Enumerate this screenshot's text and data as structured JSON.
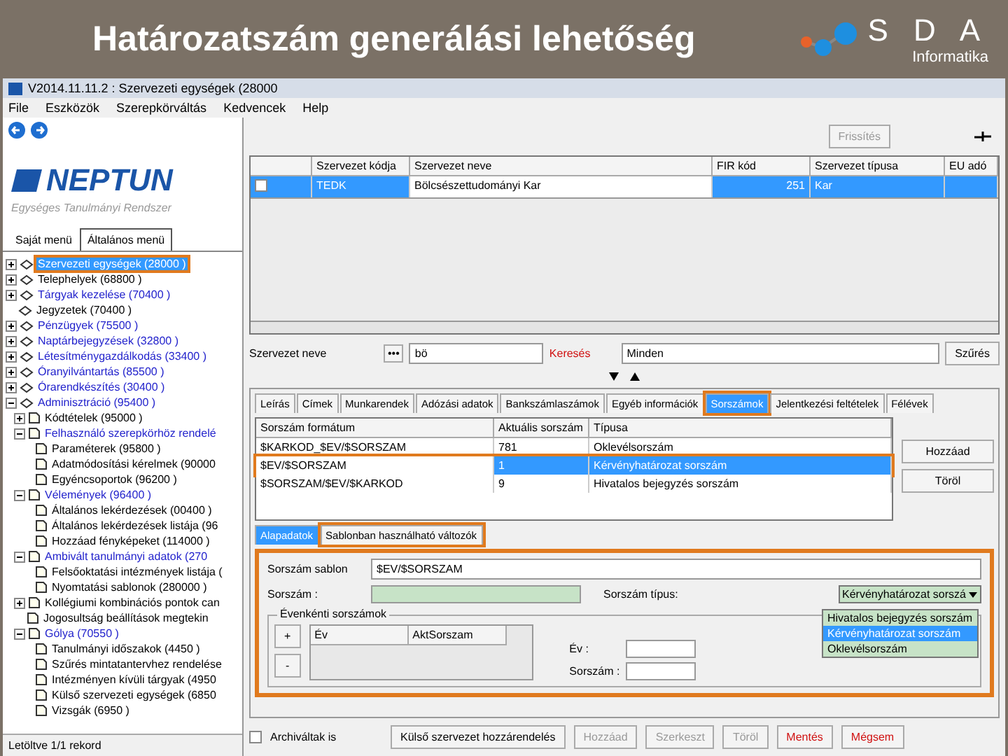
{
  "slide": {
    "title": "Határozatszám generálási lehetőség",
    "logo": {
      "letters": "S D A",
      "subtitle": "Informatika"
    }
  },
  "window": {
    "title": "V2014.11.11.2 : Szervezeti egységek (28000"
  },
  "menu": [
    "File",
    "Eszközök",
    "Szerepkörváltás",
    "Kedvencek",
    "Help"
  ],
  "sidebar": {
    "logo": "NEPTUN",
    "tagline": "Egységes Tanulmányi Rendszer",
    "tabs": [
      {
        "label": "Saját menü",
        "selected": false
      },
      {
        "label": "Általános menü",
        "selected": true
      }
    ],
    "tree": [
      {
        "label": "Szervezeti egységek (28000 )",
        "selected": true,
        "highlighted": true,
        "expanded": false
      },
      {
        "label": "Telephelyek (68800 )",
        "color": "#000000",
        "selected": false,
        "highlighted": false,
        "expanded": false
      },
      {
        "label": "Tárgyak kezelése (70400 )",
        "color": "#2222cc",
        "selected": false,
        "highlighted": false,
        "expanded": false
      },
      {
        "label": "Jegyzetek (70400 )",
        "color": "#000000",
        "selected": false,
        "highlighted": false
      },
      {
        "label": "Pénzügyek (75500 )",
        "color": "#2222cc",
        "selected": false,
        "highlighted": false,
        "expanded": false
      },
      {
        "label": "Naptárbejegyzések (32800 )",
        "color": "#2222cc",
        "selected": false,
        "highlighted": false,
        "expanded": false
      },
      {
        "label": "Létesítménygazdálkodás (33400 )",
        "color": "#2222cc",
        "selected": false,
        "highlighted": false,
        "expanded": false
      },
      {
        "label": "Óranyilvántartás (85500 )",
        "color": "#2222cc",
        "selected": false,
        "highlighted": false,
        "expanded": false
      },
      {
        "label": "Órarendkészítés (30400 )",
        "color": "#2222cc",
        "selected": false,
        "highlighted": false,
        "expanded": false
      },
      {
        "label": "Adminisztráció (95400 )",
        "color": "#2222cc",
        "selected": false,
        "highlighted": false,
        "expanded": true,
        "children": [
          {
            "label": "Kódtételek (95000 )",
            "color": "#000000",
            "selected": false,
            "highlighted": false,
            "expanded": false
          },
          {
            "label": "Felhasználó szerepkörhöz rendelé",
            "color": "#2222cc",
            "selected": false,
            "highlighted": false,
            "expanded": true,
            "children": [
              {
                "label": "Paraméterek (95800 )",
                "color": "#000000",
                "selected": false,
                "highlighted": false
              },
              {
                "label": "Adatmódosítási kérelmek (90000",
                "color": "#000000",
                "selected": false,
                "highlighted": false
              },
              {
                "label": "Egyéncsoportok (96200 )",
                "color": "#000000",
                "selected": false,
                "highlighted": false
              }
            ]
          },
          {
            "label": "Vélemények (96400 )",
            "color": "#2222cc",
            "selected": false,
            "highlighted": false,
            "expanded": true,
            "children": [
              {
                "label": "Általános lekérdezések (00400 )",
                "color": "#000000",
                "selected": false,
                "highlighted": false
              },
              {
                "label": "Általános lekérdezések listája (96",
                "color": "#000000",
                "selected": false,
                "highlighted": false
              },
              {
                "label": "Hozzáad fényképeket (114000 )",
                "color": "#000000",
                "selected": false,
                "highlighted": false
              }
            ]
          },
          {
            "label": "Ambivált tanulmányi adatok (270",
            "color": "#2222cc",
            "selected": false,
            "highlighted": false,
            "expanded": true,
            "children": [
              {
                "label": "Felsőoktatási intézmények listája (",
                "color": "#000000",
                "selected": false,
                "highlighted": false
              },
              {
                "label": "Nyomtatási sablonok (280000 )",
                "color": "#000000",
                "selected": false,
                "highlighted": false
              }
            ]
          },
          {
            "label": "Kollégiumi kombinációs pontok can",
            "color": "#000000",
            "selected": false,
            "highlighted": false,
            "expanded": false
          },
          {
            "label": "Jogosultság beállítások megtekin",
            "color": "#000000",
            "selected": false,
            "highlighted": false
          },
          {
            "label": "Gólya (70550 )",
            "color": "#2222cc",
            "selected": false,
            "highlighted": false,
            "expanded": true,
            "children": [
              {
                "label": "Tanulmányi időszakok (4450 )",
                "color": "#000000",
                "selected": false,
                "highlighted": false
              },
              {
                "label": "Szűrés mintatantervhez rendelése",
                "color": "#000000",
                "selected": false,
                "highlighted": false
              },
              {
                "label": "Intézményen kívüli tárgyak (4950",
                "color": "#000000",
                "selected": false,
                "highlighted": false
              },
              {
                "label": "Külső szervezeti egységek (6850",
                "color": "#000000",
                "selected": false,
                "highlighted": false
              },
              {
                "label": "Vizsgák (6950 )",
                "color": "#000000",
                "selected": false,
                "highlighted": false
              }
            ]
          }
        ]
      }
    ]
  },
  "status_bar": {
    "text": "Letöltve 1/1 rekord"
  },
  "list_panel": {
    "refresh_button": {
      "label": "Frissítés",
      "disabled": true
    },
    "columns": [
      "Szervezet kódja",
      "Szervezet neve",
      "FIR kód",
      "Szervezet típusa",
      "EU adó"
    ],
    "rows": [
      {
        "checked": false,
        "selected": true,
        "cells": [
          "TEDK",
          "Bölcsészettudományi Kar",
          "251",
          "Kar"
        ]
      }
    ],
    "filter": {
      "label": "Szervezet neve",
      "browse_button": "•••",
      "value": "bö",
      "search_link": "Keresés",
      "scope": "Minden",
      "filter_button": "Szűrés"
    }
  },
  "detail": {
    "tabs": [
      {
        "label": "Leírás",
        "selected": false,
        "highlighted": false
      },
      {
        "label": "Címek",
        "selected": false,
        "highlighted": false
      },
      {
        "label": "Munkarendek",
        "selected": false,
        "highlighted": false
      },
      {
        "label": "Adózási adatok",
        "selected": false,
        "highlighted": false
      },
      {
        "label": "Bankszámlaszámok",
        "selected": false,
        "highlighted": false
      },
      {
        "label": "Egyéb információk",
        "selected": false,
        "highlighted": false
      },
      {
        "label": "Sorszámok",
        "selected": true,
        "highlighted": true
      },
      {
        "label": "Jelentkezési feltételek",
        "selected": false,
        "highlighted": false
      },
      {
        "label": "Félévek",
        "selected": false,
        "highlighted": false
      }
    ],
    "numbering": {
      "columns": [
        "Sorszám formátum",
        "Aktuális sorszám",
        "Típusa"
      ],
      "rows": [
        {
          "selected": false,
          "highlighted": false,
          "cells": [
            "$KARKOD_$EV/$SORSZAM",
            "781",
            "Oklevélsorszám"
          ]
        },
        {
          "selected": true,
          "highlighted": true,
          "cells": [
            "$EV/$SORSZAM",
            "1",
            "Kérvényhatározat sorszám"
          ]
        },
        {
          "selected": false,
          "highlighted": false,
          "cells": [
            "$SORSZAM/$EV/$KARKOD",
            "9",
            "Hivatalos bejegyzés sorszám"
          ]
        }
      ]
    },
    "buttons": [
      "Hozzáad",
      "Töröl"
    ],
    "subtabs": [
      {
        "label": "Alapadatok",
        "selected": true,
        "highlighted": false
      },
      {
        "label": "Sablonban használható változók",
        "selected": false,
        "highlighted": true
      }
    ],
    "form": {
      "highlighted": true,
      "template_label": "Sorszám sablon",
      "template_value": "$EV/$SORSZAM",
      "number_label": "Sorszám :",
      "type_label": "Sorszám típus:",
      "type_value": "Kérvényhatározat sorszá",
      "type_options": [
        {
          "label": "Hivatalos bejegyzés sorszám",
          "selected": false
        },
        {
          "label": "Kérvényhatározat sorszám",
          "selected": true
        },
        {
          "label": "Oklevélsorszám",
          "selected": false
        }
      ],
      "yearly": {
        "title": "Évenkénti sorszámok",
        "add": "+",
        "remove": "-",
        "columns": [
          "Év",
          "AktSorszam"
        ],
        "year_label": "Év :",
        "number_label": "Sorszám :"
      }
    }
  },
  "footer": {
    "archived": {
      "label": "Archiváltak is",
      "checked": false
    },
    "buttons": [
      {
        "label": "Külső szervezet hozzárendelés",
        "kind": "normal"
      },
      {
        "label": "Hozzáad",
        "kind": "disabled"
      },
      {
        "label": "Szerkeszt",
        "kind": "disabled"
      },
      {
        "label": "Töröl",
        "kind": "disabled"
      },
      {
        "label": "Mentés",
        "kind": "danger"
      },
      {
        "label": "Mégsem",
        "kind": "danger"
      }
    ]
  }
}
